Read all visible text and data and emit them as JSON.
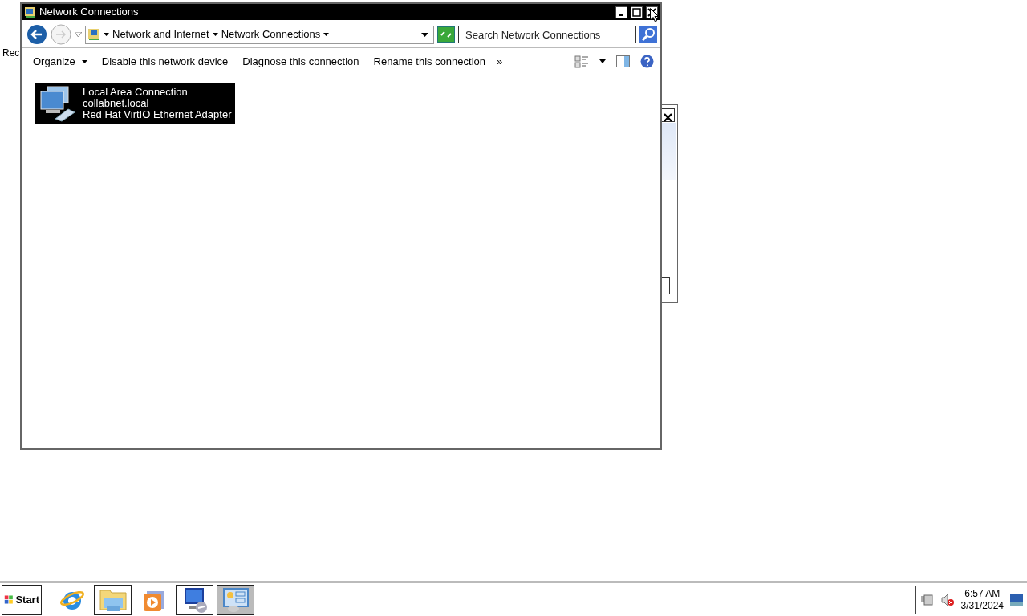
{
  "desktop": {
    "icon_labels": [
      "Rec"
    ]
  },
  "window": {
    "title": "Network Connections"
  },
  "address_bar": {
    "breadcrumbs": [
      "Network and Internet",
      "Network Connections"
    ]
  },
  "search": {
    "placeholder": "Search Network Connections"
  },
  "toolbar": {
    "commands": [
      {
        "label": "Organize",
        "kind": "menu"
      },
      {
        "label": "Disable this network device",
        "kind": "plain"
      },
      {
        "label": "Diagnose this connection",
        "kind": "plain"
      },
      {
        "label": "Rename this connection",
        "kind": "plain"
      },
      {
        "label": "»",
        "kind": "overflow"
      }
    ]
  },
  "connections": [
    {
      "name": "Local Area Connection",
      "network": "collabnet.local",
      "adapter": "Red Hat VirtIO Ethernet Adapter",
      "selected": true
    }
  ],
  "taskbar": {
    "start": "Start",
    "buttons": [
      {
        "open": false,
        "selected": false
      },
      {
        "open": true,
        "selected": false
      },
      {
        "open": false,
        "selected": false
      },
      {
        "open": true,
        "selected": false
      },
      {
        "open": true,
        "selected": true
      }
    ]
  },
  "clock": {
    "time": "6:57 AM",
    "date": "3/31/2024"
  }
}
